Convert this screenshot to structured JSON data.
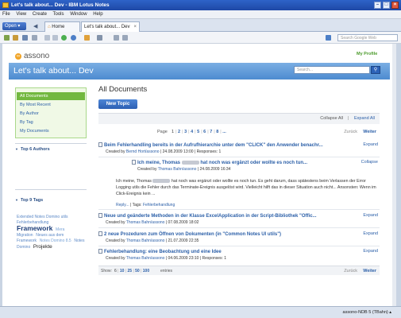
{
  "window": {
    "title": "Let's talk about... Dev - IBM Lotus Notes"
  },
  "menu": [
    "File",
    "View",
    "Create",
    "Tools",
    "Window",
    "Help"
  ],
  "tabs": {
    "open_label": "Open ▾",
    "home_label": "Home",
    "doc_label": "Let's talk about... Dev"
  },
  "toolbar": {
    "search_placeholder": "Search Google Web"
  },
  "site": {
    "logo_text": "assono",
    "my_profile": "My Profile",
    "banner_title": "Let's talk about... Dev",
    "search_placeholder": "Search..."
  },
  "nav": {
    "items": [
      "All Documents",
      "By Most Recent",
      "By Author",
      "By Tag",
      "My Documents"
    ],
    "selected_index": 0
  },
  "authors": {
    "heading": "Top 6 Authors"
  },
  "tags": {
    "heading": "Top 9 Tags",
    "cloud": [
      {
        "text": "Extended Notes Domino utils",
        "size": 5,
        "color": "#5b88c6"
      },
      {
        "text": "Fehlerbehandlung",
        "size": 5,
        "color": "#5b88c6"
      },
      {
        "text": "Framework",
        "size": 8.5,
        "color": "#1e3f7a",
        "bold": true
      },
      {
        "text": "Mera",
        "size": 5,
        "color": "#7aa4d8"
      },
      {
        "text": "Migration",
        "size": 5,
        "color": "#5b88c6"
      },
      {
        "text": "Neues aus dem",
        "size": 5,
        "color": "#5b88c6"
      },
      {
        "text": "Framework",
        "size": 5,
        "color": "#5b88c6"
      },
      {
        "text": "Notes Domino 8.5",
        "size": 5,
        "color": "#7aa4d8"
      },
      {
        "text": "Notes Domino",
        "size": 5,
        "color": "#5b88c6"
      },
      {
        "text": "Projekte",
        "size": 6.5,
        "color": "#222222"
      }
    ]
  },
  "main": {
    "heading": "All Documents",
    "new_topic": "New Topic",
    "collapse_all": "Collapse All",
    "separator": "|",
    "expand_all": "Expand All",
    "page_label": "Page",
    "pages": [
      "1",
      "2",
      "3",
      "4",
      "5",
      "6",
      "7",
      "8",
      "..."
    ],
    "back": "Zurück",
    "next": "Weiter",
    "show_label": "Show:",
    "show_options": [
      "6",
      "10",
      "25",
      "50",
      "100"
    ],
    "show_suffix": "entries"
  },
  "documents": [
    {
      "title": "Beim Fehlerhandling bereits in der Aufrufhierarchie unter dem \"CLICK\" den Anwender benachr...",
      "meta_prefix": "Created by",
      "author": "Bernd Hort/assono",
      "date": "| 24.08.2009 13:00 |",
      "responses": "Responses: 1",
      "action": "Expand"
    },
    {
      "title": "Ich meine, Thomas",
      "title_rest": "hat noch was ergänzt oder wollte es noch tun...",
      "meta_prefix": "Created by",
      "author": "Thomas Bahn/assono",
      "date": "| 24.08.2009 16:34",
      "action": "Collapse",
      "body_start": "Ich meine, Thomas",
      "body_rest": "hat noch was ergänzt oder wollte es noch tun. Es geht darum, dass spätestens beim Verlassen der Error Logging utils die Fehler durch das Terminate-Ereignis ausgelöst wird. Vielleicht hilft das in dieser Situation auch nicht... Ansonsten: Wenn im Click-Ereignis kein ...",
      "reply": "Reply...",
      "tags_label": "| Tags:",
      "tag": "Fehlerbehandlung"
    },
    {
      "title": "Neue und geänderte Methoden in der Klasse ExcelApplication in der Script-Bibliothek \"Offic...",
      "meta_prefix": "Created by",
      "author": "Thomas Bahn/assono",
      "date": "| 07.08.2009 18:02",
      "action": "Expand"
    },
    {
      "title": "2 neue Prozeduren zum Öffnen von Dokumenten (in \"Common Notes UI utils\")",
      "meta_prefix": "Created by",
      "author": "Thomas Bahn/assono",
      "date": "| 21.07.2009 22:35",
      "action": "Expand"
    },
    {
      "title": "Fehlerbehandlung: eine Beobachtung und eine Idee",
      "meta_prefix": "Created by",
      "author": "Thomas Bahn/assono",
      "date": "| 04.06.2009 23:10 |",
      "responses": "Responses: 1",
      "action": "Expand"
    }
  ],
  "status": {
    "server": "assono-NDB 5 (TBahn) ▴"
  }
}
